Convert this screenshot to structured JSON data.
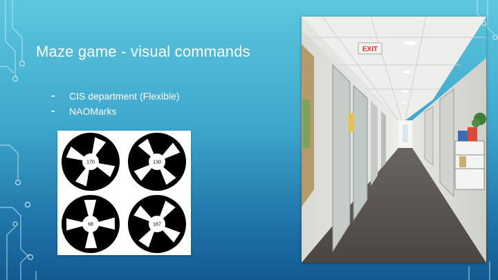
{
  "slide": {
    "title": "Maze game - visual commands",
    "bullets": [
      {
        "marker": "-",
        "text": "CIS department (Flexible)"
      },
      {
        "marker": "-",
        "text": "NAOMarks"
      }
    ],
    "naomarks": [
      {
        "label": "170"
      },
      {
        "label": "130"
      },
      {
        "label": "68"
      },
      {
        "label": "187"
      }
    ],
    "photo": {
      "exit_sign": "EXIT"
    }
  },
  "colors": {
    "background_top": "#5cc7dd",
    "background_bottom": "#125a92",
    "title_text": "#ffffff",
    "circuit_lines": "#bfeaf4",
    "exit_sign": "#e8352b"
  }
}
